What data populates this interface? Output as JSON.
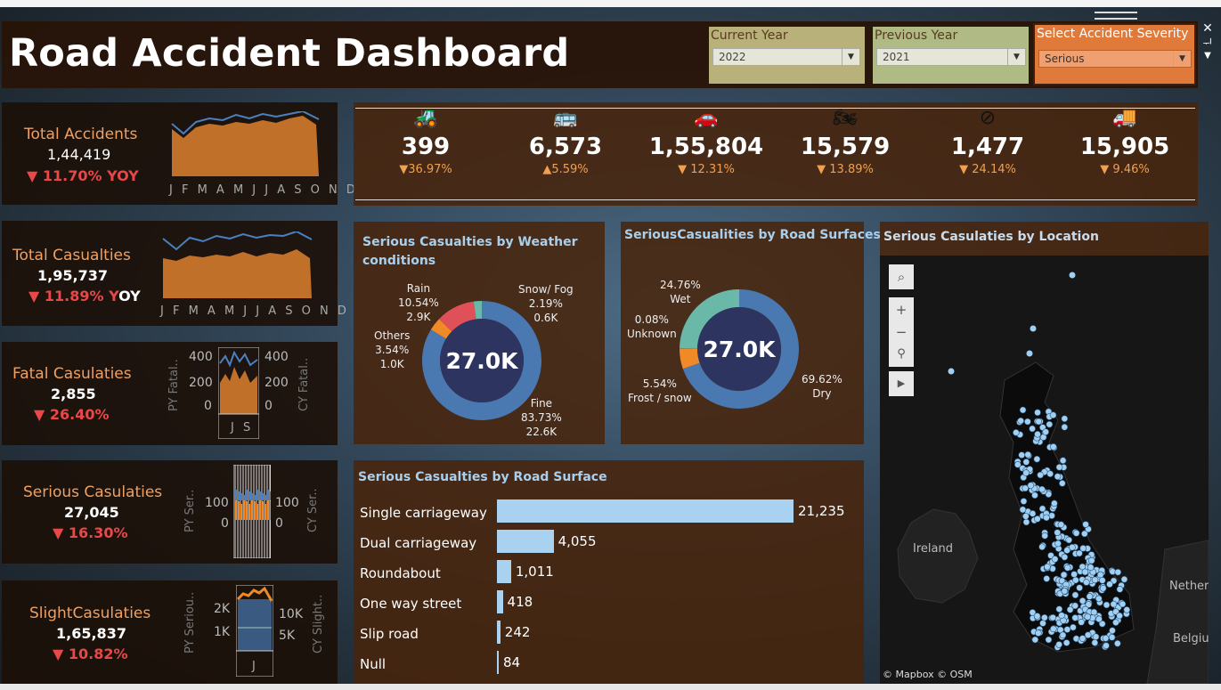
{
  "header": {
    "title": "Road Accident Dashboard",
    "filters": [
      {
        "label": "Current Year",
        "value": "2022",
        "bg": "#b8b27a"
      },
      {
        "label": "Previous  Year",
        "value": "2021",
        "bg": "#b0ba84"
      },
      {
        "label": "Select Accident Severity",
        "value": "Serious",
        "bg": "#e07a3a"
      }
    ]
  },
  "kpis": {
    "total_accidents": {
      "label": "Total Accidents",
      "value": "1,44,419",
      "yoy": "▼ 11.70% YOY",
      "months": "J F M A M J J A S O N D"
    },
    "total_casualties": {
      "label": "Total Casualties",
      "value": "1,95,737",
      "yoy_a": "▼ 11.89% Y",
      "yoy_b": "OY",
      "months": "J F M A M J J A S O N D"
    },
    "fatal": {
      "label": "Fatal Casulaties",
      "value": "2,855",
      "yoy": "▼ 26.40%",
      "ax_left_hi": "400",
      "ax_left_mid": "200",
      "ax_left_lo": "0",
      "ax_right_hi": "400",
      "ax_right_mid": "200",
      "ax_right_lo": "0",
      "py": "PY Fatal..",
      "cy": "CY Fatal..",
      "months": "J S"
    },
    "serious": {
      "label": "Serious Casulaties",
      "value": "27,045",
      "yoy": "▼ 16.30%",
      "ax_left_hi": "100",
      "ax_left_lo": "0",
      "ax_right_hi": "100",
      "ax_right_lo": "0",
      "py": "PY Ser..",
      "cy": "CY Ser.."
    },
    "slight": {
      "label": "SlightCasulaties",
      "value": "1,65,837",
      "yoy": "▼ 10.82%",
      "ax_left_hi": "2K",
      "ax_left_lo": "1K",
      "ax_right_hi": "10K",
      "ax_right_lo": "5K",
      "py": "PY Seriou..",
      "cy": "CY Slight..",
      "months": "J"
    }
  },
  "vehicles": [
    {
      "icon": "tractor-icon",
      "glyph": "🚜",
      "value": "399",
      "pct": "▼36.97%"
    },
    {
      "icon": "bus-icon",
      "glyph": "🚌",
      "value": "6,573",
      "pct": "▲5.59%"
    },
    {
      "icon": "car-icon",
      "glyph": "🚗",
      "value": "1,55,804",
      "pct": "▼ 12.31%"
    },
    {
      "icon": "motorcycle-icon",
      "glyph": "🏍",
      "value": "15,579",
      "pct": "▼ 13.89%"
    },
    {
      "icon": "no-entry-icon",
      "glyph": "⊘",
      "value": "1,477",
      "pct": "▼ 24.14%"
    },
    {
      "icon": "truck-icon",
      "glyph": "🚚",
      "value": "15,905",
      "pct": "▼ 9.46%"
    }
  ],
  "weather": {
    "title_a": "Serious Casualties by Weather",
    "title_b": "conditions",
    "center": "27.0K",
    "labels": {
      "rain": [
        "Rain",
        "10.54%",
        "2.9K"
      ],
      "snow": [
        "Snow/ Fog",
        "2.19%",
        "0.6K"
      ],
      "others": [
        "Others",
        "3.54%",
        "1.0K"
      ],
      "fine": [
        "Fine",
        "83.73%",
        "22.6K"
      ]
    },
    "slices": [
      {
        "name": "Fine",
        "pct": 83.73,
        "color": "#4a78b0"
      },
      {
        "name": "Others",
        "pct": 3.54,
        "color": "#f08a28"
      },
      {
        "name": "Rain",
        "pct": 10.54,
        "color": "#e05058"
      },
      {
        "name": "Snow/ Fog",
        "pct": 2.19,
        "color": "#6ab8a8"
      }
    ]
  },
  "road_surfaces": {
    "title": "SeriousCasualities by Road Surfaces",
    "center": "27.0K",
    "labels": {
      "wet": [
        "24.76%",
        "Wet"
      ],
      "unknown": [
        "0.08%",
        "Unknown"
      ],
      "frost": [
        "5.54%",
        "Frost / snow"
      ],
      "dry": [
        "69.62%",
        "Dry"
      ]
    },
    "slices": [
      {
        "name": "Dry",
        "pct": 69.62,
        "color": "#4a78b0"
      },
      {
        "name": "Frost / snow",
        "pct": 5.54,
        "color": "#f08a28"
      },
      {
        "name": "Unknown",
        "pct": 0.08,
        "color": "#e05058"
      },
      {
        "name": "Wet",
        "pct": 24.76,
        "color": "#6ab8a8"
      }
    ]
  },
  "chart_data": {
    "type": "bar",
    "title": "Serious Casualties by Road Surface",
    "categories": [
      "Single carriageway",
      "Dual carriageway",
      "Roundabout",
      "One way street",
      "Slip road",
      "Null"
    ],
    "values": [
      21235,
      4055,
      1011,
      418,
      242,
      84
    ],
    "value_labels": [
      "21,235",
      "4,055",
      "1,011",
      "418",
      "242",
      "84"
    ]
  },
  "map": {
    "title": "Serious Casulaties by Location",
    "label_ireland": "Ireland",
    "label_nether": "Nether",
    "label_belgium": "Belgiu",
    "attribution": "© Mapbox © OSM"
  }
}
